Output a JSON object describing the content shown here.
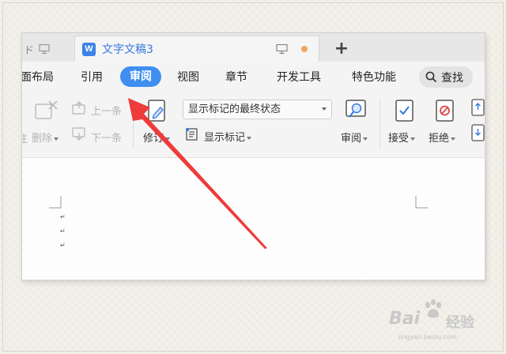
{
  "tabs": {
    "prev_tab_fragment": "ド",
    "active_tab_logo": "W",
    "active_tab_title": "文字文稿3",
    "new_tab_symbol": "+"
  },
  "menu": {
    "items": [
      "面布局",
      "引用",
      "审阅",
      "视图",
      "章节",
      "开发工具",
      "特色功能"
    ],
    "active": "审阅",
    "search_label": "查找"
  },
  "toolbar": {
    "left_fragment": "注",
    "delete_label": "删除",
    "prev_label": "上一条",
    "next_label": "下一条",
    "revise_label": "修订",
    "markup_dropdown_value": "显示标记的最终状态",
    "show_markup_label": "显示标记",
    "review_label": "审阅",
    "accept_label": "接受",
    "reject_label": "拒绝"
  },
  "document": {
    "paragraph_marks": [
      "↵",
      "↵",
      "↵"
    ]
  },
  "watermark": {
    "brand": "Bai",
    "brand_suffix": "经验",
    "url": "jingyan.baidu.com"
  },
  "colors": {
    "accent": "#3f8ff0",
    "arrow": "#ee3b3b",
    "tab_title": "#3478e0"
  }
}
